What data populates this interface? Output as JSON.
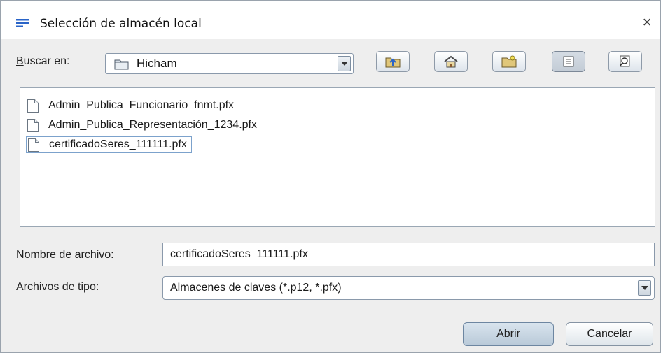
{
  "window": {
    "title": "Selección de almacén local",
    "close_symbol": "×"
  },
  "toolbar": {
    "look_in_label_mnemonic": "B",
    "look_in_label_rest": "uscar en:",
    "look_in_value": "Hicham",
    "buttons": [
      "up-one-level-icon",
      "home-icon",
      "new-folder-icon",
      "list-view-icon",
      "details-view-icon"
    ]
  },
  "files": [
    {
      "name": "Admin_Publica_Funcionario_fnmt.pfx"
    },
    {
      "name": "Admin_Publica_Representación_1234.pfx"
    },
    {
      "name": "certificadoSeres_111111.pfx",
      "selected": true
    }
  ],
  "filename": {
    "label_mnemonic": "N",
    "label_rest": "ombre de archivo:",
    "value": "certificadoSeres_111111.pfx"
  },
  "filetype": {
    "label_pre": "Archivos de ",
    "label_mnemonic": "t",
    "label_rest": "ipo:",
    "value": "Almacenes de claves (*.p12, *.pfx)"
  },
  "actions": {
    "open": "Abrir",
    "cancel": "Cancelar"
  },
  "colors": {
    "accent": "#2a64c8",
    "selection_border": "#7ca2cc"
  }
}
